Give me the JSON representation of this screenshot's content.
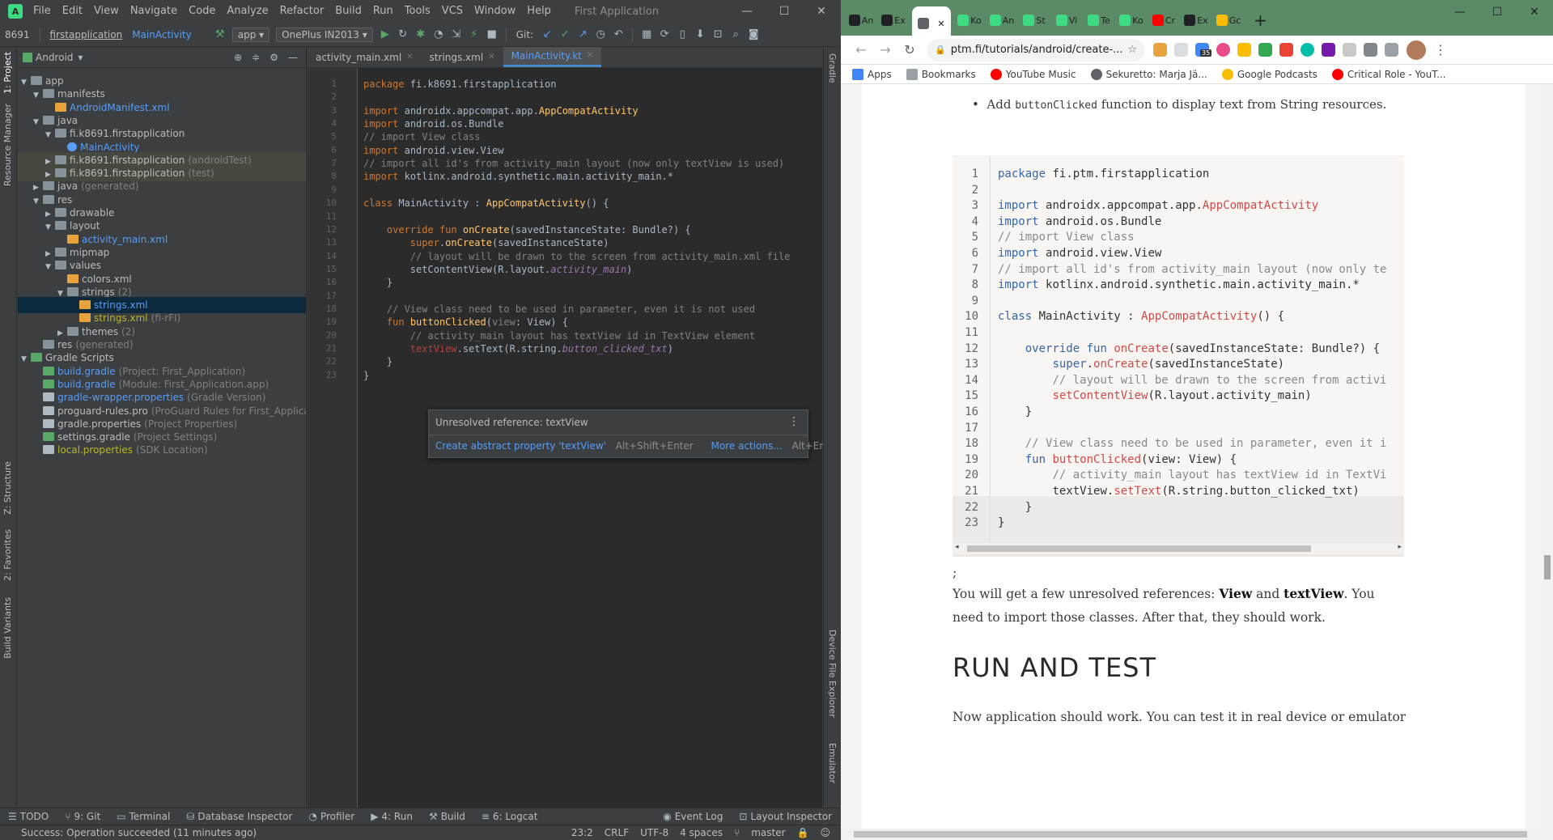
{
  "ide": {
    "menu": [
      "File",
      "Edit",
      "View",
      "Navigate",
      "Code",
      "Analyze",
      "Refactor",
      "Build",
      "Run",
      "Tools",
      "VCS",
      "Window",
      "Help"
    ],
    "window_title": "First Application",
    "window_controls": {
      "minimize": "—",
      "maximize": "☐",
      "close": "✕"
    },
    "toolbar": {
      "crumb_prefix": "8691",
      "crumb_project": "firstapplication",
      "crumb_class": "MainActivity",
      "config": "app ▾",
      "device": "OnePlus IN2013 ▾",
      "git_label": "Git:"
    },
    "left_tabs": [
      "1: Project",
      "Resource Manager",
      "Z: Structure",
      "2: Favorites",
      "Build Variants"
    ],
    "right_tabs": [
      "Gradle",
      "Device File Explorer",
      "Emulator"
    ],
    "project_panel": {
      "view_mode": "Android",
      "tree": [
        {
          "label": "app",
          "extra": ""
        },
        {
          "label": "manifests",
          "extra": ""
        },
        {
          "label": "AndroidManifest.xml",
          "extra": ""
        },
        {
          "label": "java",
          "extra": ""
        },
        {
          "label": "fi.k8691.firstapplication",
          "extra": ""
        },
        {
          "label": "MainActivity",
          "extra": ""
        },
        {
          "label": "fi.k8691.firstapplication",
          "extra": "(androidTest)"
        },
        {
          "label": "fi.k8691.firstapplication",
          "extra": "(test)"
        },
        {
          "label": "java",
          "extra": "(generated)"
        },
        {
          "label": "res",
          "extra": ""
        },
        {
          "label": "drawable",
          "extra": ""
        },
        {
          "label": "layout",
          "extra": ""
        },
        {
          "label": "activity_main.xml",
          "extra": ""
        },
        {
          "label": "mipmap",
          "extra": ""
        },
        {
          "label": "values",
          "extra": ""
        },
        {
          "label": "colors.xml",
          "extra": ""
        },
        {
          "label": "strings",
          "extra": "(2)"
        },
        {
          "label": "strings.xml",
          "extra": ""
        },
        {
          "label": "strings.xml",
          "extra": "(fi-rFI)"
        },
        {
          "label": "themes",
          "extra": "(2)"
        },
        {
          "label": "res",
          "extra": "(generated)"
        },
        {
          "label": "Gradle Scripts",
          "extra": ""
        },
        {
          "label": "build.gradle",
          "extra": "(Project: First_Application)"
        },
        {
          "label": "build.gradle",
          "extra": "(Module: First_Application.app)"
        },
        {
          "label": "gradle-wrapper.properties",
          "extra": "(Gradle Version)"
        },
        {
          "label": "proguard-rules.pro",
          "extra": "(ProGuard Rules for First_Application.app)"
        },
        {
          "label": "gradle.properties",
          "extra": "(Project Properties)"
        },
        {
          "label": "settings.gradle",
          "extra": "(Project Settings)"
        },
        {
          "label": "local.properties",
          "extra": "(SDK Location)"
        }
      ]
    },
    "editor_tabs": [
      "activity_main.xml",
      "strings.xml",
      "MainActivity.kt"
    ],
    "code_lines": [
      "package fi.k8691.firstapplication",
      "",
      "import androidx.appcompat.app.AppCompatActivity",
      "import android.os.Bundle",
      "// import View class",
      "import android.view.View",
      "// import all id's from activity_main layout (now only textView is used)",
      "import kotlinx.android.synthetic.main.activity_main.*",
      "",
      "class MainActivity : AppCompatActivity() {",
      "",
      "    override fun onCreate(savedInstanceState: Bundle?) {",
      "        super.onCreate(savedInstanceState)",
      "        // layout will be drawn to the screen from activity_main.xml file",
      "        setContentView(R.layout.activity_main)",
      "    }",
      "",
      "    // View class need to be used in parameter, even it is not used",
      "    fun buttonClicked(view: View) {",
      "        // activity_main layout has textView id in TextView element",
      "        textView.setText(R.string.button_clicked_txt)",
      "    }",
      "}"
    ],
    "popup": {
      "message": "Unresolved reference: textView",
      "action1": "Create abstract property 'textView'",
      "shortcut1": "Alt+Shift+Enter",
      "action2": "More actions...",
      "shortcut2": "Alt+Enter"
    },
    "bottom_tools": [
      "TODO",
      "9: Git",
      "Terminal",
      "Database Inspector",
      "Profiler",
      "4: Run",
      "Build",
      "6: Logcat",
      "Event Log",
      "Layout Inspector"
    ],
    "status": {
      "message": "Success: Operation succeeded (11 minutes ago)",
      "position": "23:2",
      "line_sep": "CRLF",
      "encoding": "UTF-8",
      "indent": "4 spaces",
      "branch": "master"
    }
  },
  "browser": {
    "tabs": [
      "An",
      "Ex",
      "",
      "Ko",
      "An",
      "St",
      "Vi",
      "Te",
      "Ko",
      "Cr",
      "Ex",
      "Gc"
    ],
    "url": "ptm.fi/tutorials/android/create-...",
    "bookmarks": [
      "Apps",
      "Bookmarks",
      "YouTube Music",
      "Sekuretto: Marja Jä...",
      "Google Podcasts",
      "Critical Role - YouT..."
    ],
    "extension_badge": "35",
    "bullet_text_pre": "Add ",
    "bullet_code": "buttonClicked",
    "bullet_text_post": " function to display text from String resources.",
    "code_lines": [
      "package fi.ptm.firstapplication",
      "",
      "import androidx.appcompat.app.AppCompatActivity",
      "import android.os.Bundle",
      "// import View class",
      "import android.view.View",
      "// import all id's from activity_main layout (now only te",
      "import kotlinx.android.synthetic.main.activity_main.*",
      "",
      "class MainActivity : AppCompatActivity() {",
      "",
      "    override fun onCreate(savedInstanceState: Bundle?) {",
      "        super.onCreate(savedInstanceState)",
      "        // layout will be drawn to the screen from activi",
      "        setContentView(R.layout.activity_main)",
      "    }",
      "",
      "    // View class need to be used in parameter, even it i",
      "    fun buttonClicked(view: View) {",
      "        // activity_main layout has textView id in TextVi",
      "        textView.setText(R.string.button_clicked_txt)",
      "    }",
      "}"
    ],
    "semicolon": ";",
    "para1_pre": "You will get a few unresolved references: ",
    "para1_b1": "View",
    "para1_mid": " and ",
    "para1_b2": "textView",
    "para1_post": ". You need to import those classes. After that, they should work.",
    "heading": "RUN AND TEST",
    "para2": "Now application should work. You can test it in real device or emulator."
  }
}
